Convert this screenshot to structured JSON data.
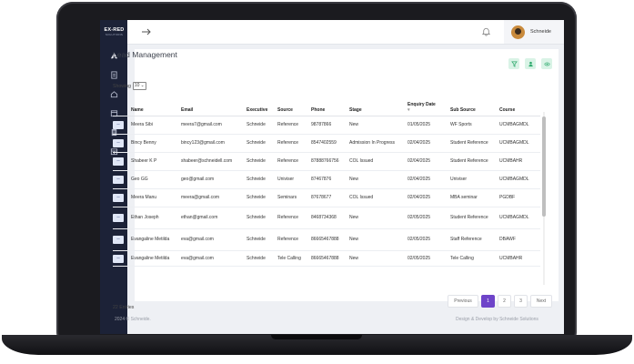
{
  "brand": {
    "logo": "EX-RED",
    "logo_sub": "SOLUTIONS"
  },
  "topbar": {
    "user_name": "Schneide"
  },
  "page": {
    "title": "Lead Management",
    "showing_label": "Showing",
    "page_size": "10",
    "entries": "22 Entries"
  },
  "table": {
    "columns": [
      "Name",
      "Email",
      "Executive",
      "Source",
      "Phone",
      "Stage",
      "Enquiry Date",
      "Sub Source",
      "Course"
    ],
    "rows": [
      {
        "name": "Meera Sibi",
        "email": "meera7@gmail.com",
        "executive": "Schneide",
        "source": "Reference",
        "phone": "98787866",
        "stage": "New",
        "date": "01/05/2025",
        "sub_source": "WF Sports",
        "course": "UCMBAGMDL"
      },
      {
        "name": "Bincy Benny",
        "email": "bincy123@gmail.com",
        "executive": "Schneide",
        "source": "Reference",
        "phone": "8547402559",
        "stage": "Admission In Progress",
        "date": "02/04/2025",
        "sub_source": "Student Reference",
        "course": "UCMBAGMDL"
      },
      {
        "name": "Shabeer K P",
        "email": "shabeer@schneidell.com",
        "executive": "Schneide",
        "source": "Reference",
        "phone": "87888766756",
        "stage": "COL Issued",
        "date": "02/04/2025",
        "sub_source": "Student Reference",
        "course": "UCMBAHR"
      },
      {
        "name": "Geo GG",
        "email": "geo@gmail.com",
        "executive": "Schneide",
        "source": "Univiser",
        "phone": "87467876",
        "stage": "New",
        "date": "02/04/2025",
        "sub_source": "Univiser",
        "course": "UCMBAGMDL"
      },
      {
        "name": "Meera Manu",
        "email": "meera@gmail.com",
        "executive": "Schneide",
        "source": "Seminars",
        "phone": "87678677",
        "stage": "COL Issued",
        "date": "02/04/2025",
        "sub_source": "MBA seminar",
        "course": "PGDBF"
      },
      {
        "name": "Ethan Joseph",
        "email": "ethan@gmail.com",
        "executive": "Schneide",
        "source": "Reference",
        "phone": "8468734368",
        "stage": "New",
        "date": "02/05/2025",
        "sub_source": "Student Reference",
        "course": "UCMBAGMDL"
      },
      {
        "name": "Evangaline Metilda",
        "email": "eva@gmail.com",
        "executive": "Schneide",
        "source": "Reference",
        "phone": "86665467888",
        "stage": "New",
        "date": "02/05/2025",
        "sub_source": "Staff Reference",
        "course": "DBAWF"
      },
      {
        "name": "Evangaline Metilda",
        "email": "eva@gmail.com",
        "executive": "Schneide",
        "source": "Tele Calling",
        "phone": "86665467888",
        "stage": "New",
        "date": "02/05/2025",
        "sub_source": "Tele Calling",
        "course": "UCMBAHR"
      }
    ]
  },
  "pagination": {
    "previous": "Previous",
    "pages": [
      "1",
      "2",
      "3"
    ],
    "next": "Next"
  },
  "footer": {
    "left": "2024 © Schneide.",
    "right": "Design & Develop by Schneide Solutions"
  },
  "colors": {
    "sidebar": "#1c2237",
    "accent": "#6e44c9",
    "action_button": "#d9f3e6",
    "edit_button": "#dfe6f6"
  },
  "icons": [
    "home-icon",
    "list-icon",
    "house-icon",
    "calendar-icon",
    "document-icon",
    "calendar-grid-icon",
    "arrow-right-icon",
    "bell-icon",
    "filter-icon",
    "add-user-icon",
    "view-icon"
  ]
}
